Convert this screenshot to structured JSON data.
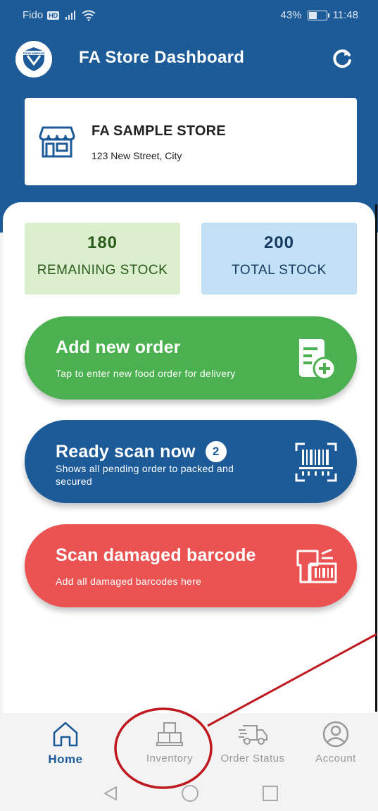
{
  "status_bar": {
    "carrier": "Fido",
    "hd": "HD",
    "battery": "43%",
    "time": "11:48"
  },
  "app_bar": {
    "title": "FA Store Dashboard",
    "logo_text": "FOOD ARMOUR"
  },
  "store": {
    "name": "FA SAMPLE STORE",
    "address": "123 New Street, City"
  },
  "stats": {
    "remaining_value": "180",
    "remaining_label": "REMAINING STOCK",
    "total_value": "200",
    "total_label": "TOTAL STOCK"
  },
  "actions": {
    "add_order_title": "Add new order",
    "add_order_sub": "Tap to enter new food order for delivery",
    "ready_scan_title": "Ready scan now",
    "ready_scan_count": "2",
    "ready_scan_sub": "Shows all pending order to packed and secured",
    "damaged_title": "Scan damaged barcode",
    "damaged_sub": "Add all damaged barcodes here"
  },
  "bottom_nav": {
    "home": "Home",
    "inventory": "Inventory",
    "order_status": "Order Status",
    "account": "Account"
  },
  "colors": {
    "primary": "#1c5b98",
    "green": "#4bb04f",
    "red": "#eb5252",
    "annotation": "#c0181f"
  }
}
